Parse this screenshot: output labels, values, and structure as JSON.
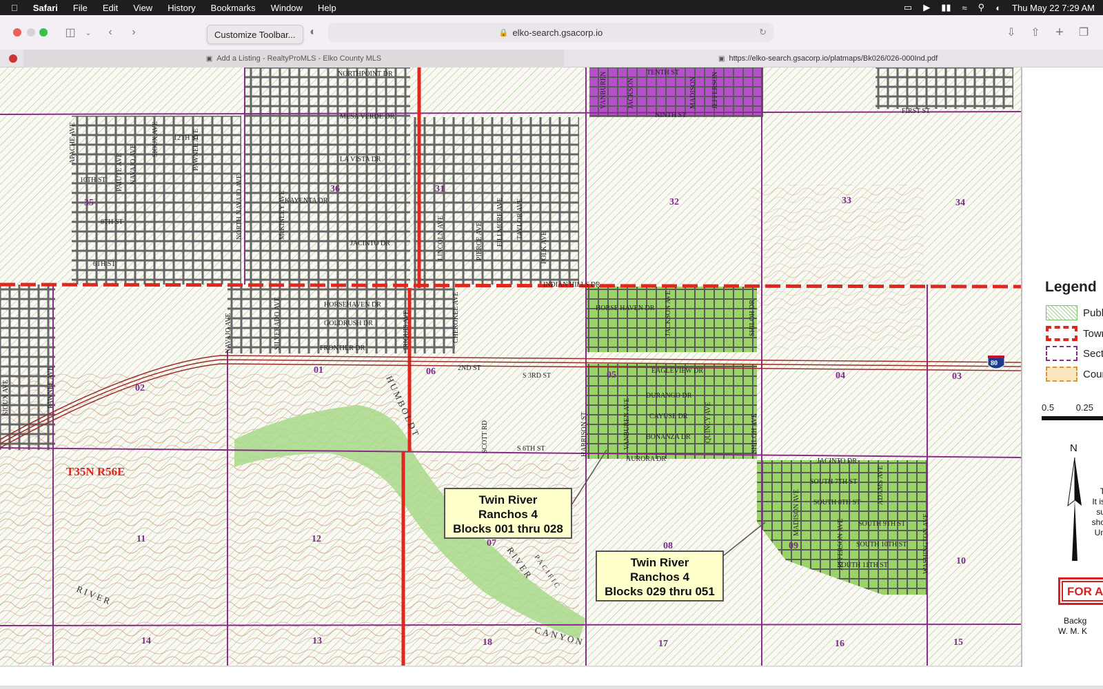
{
  "menubar": {
    "apple": "",
    "app": "Safari",
    "items": [
      "File",
      "Edit",
      "View",
      "History",
      "Bookmarks",
      "Window",
      "Help"
    ],
    "datetime": "Thu May 22  7:29 AM"
  },
  "toolbar": {
    "tooltip": "Customize Toolbar...",
    "address": "elko-search.gsacorp.io"
  },
  "tabs": [
    {
      "label": "Add a Listing - RealtyProMLS - Elko County MLS",
      "active": false
    },
    {
      "label": "https://elko-search.gsacorp.io/platmaps/Bk026/026-000Ind.pdf",
      "active": true
    }
  ],
  "map": {
    "township": "T35N R56E",
    "sections": [
      "35",
      "36",
      "31",
      "32",
      "33",
      "34",
      "02",
      "01",
      "06",
      "05",
      "04",
      "03",
      "11",
      "12",
      "07",
      "08",
      "09",
      "10",
      "14",
      "13",
      "18",
      "17",
      "16",
      "15"
    ],
    "streets": [
      "NORTHPOINT DR",
      "MESA VERDE DR",
      "LA VISTA DR",
      "KAYENTA DR",
      "JACINTO DR",
      "12TH ST",
      "10TH ST",
      "8TH ST",
      "6TH ST",
      "TENTH ST",
      "NINTH ST",
      "FIRST ST",
      "INDIAN HILLS DR",
      "HORSEHAVEN DR",
      "GOLDRUSH DR",
      "FRONTIER DR",
      "HORSE HAVEN DR",
      "EAGLEVIEW DR",
      "DURANGO DR",
      "CAYUSE DR",
      "BONANZA DR",
      "AURORA DR",
      "JACINTO DR",
      "SOUTH 7TH ST",
      "SOUTH 8TH ST",
      "SOUTH 9TH ST",
      "SOUTH 10TH ST",
      "SOUTH 11TH ST",
      "2ND ST",
      "S 3RD ST",
      "S 6TH ST"
    ],
    "vertical_streets": [
      "APACHE AVE",
      "PAIUTE AVE",
      "NAVAJO AVE",
      "SIOUX AVE",
      "PAWNEE AVE",
      "NORTH NAVAJO AVE",
      "McKINLEY AVE",
      "LINCOLN AVE",
      "PIERCE AVE",
      "FILLMORE AVE",
      "TAYLOR AVE",
      "POLK AVE",
      "VANBUREN",
      "JACKSON",
      "MADISON",
      "JEFFERSON",
      "JACKSON AVE",
      "SHILOH DR",
      "HARRISON ST",
      "VANBUREN AVE",
      "QUINCY AVE",
      "SHILOH AVE",
      "MADISON AVE",
      "JEFFERSON AVE",
      "ADAMS AVE",
      "WASHINGTON AVE",
      "SILVERADO AVE",
      "IRIQUIS AVE",
      "CHEROKEE AVE",
      "SCOTT RD",
      "SIOUX AVE",
      "PAWNEE AVE",
      "NAVAJO AVE"
    ],
    "terrain_labels": [
      "HUMBOLDT",
      "RIVER",
      "CANYON",
      "RIVER",
      "PACIFIC"
    ],
    "interstate": "80",
    "callouts": [
      {
        "lines": [
          "Twin River",
          "Ranchos 4",
          "Blocks 001 thru 028"
        ]
      },
      {
        "lines": [
          "Twin River",
          "Ranchos 4",
          "Blocks 029 thru 051"
        ]
      }
    ]
  },
  "legend": {
    "title": "Legend",
    "items": [
      "Publ",
      "Town",
      "Secti",
      "Coun"
    ],
    "scale": [
      "0.5",
      "0.25"
    ],
    "north": "N",
    "sign": "FOR A",
    "fragments": [
      "T",
      "It is",
      "su",
      "sho",
      "Un"
    ],
    "credit": [
      "Backg",
      "W. M. K"
    ]
  },
  "colors": {
    "public_land": "#7fbf6a",
    "township_boundary": "#e0261d",
    "section_line": "#8a2a8a",
    "purple_area": "#b450c8",
    "green_area": "#9ad468",
    "callout_bg": "#ffffcc"
  }
}
